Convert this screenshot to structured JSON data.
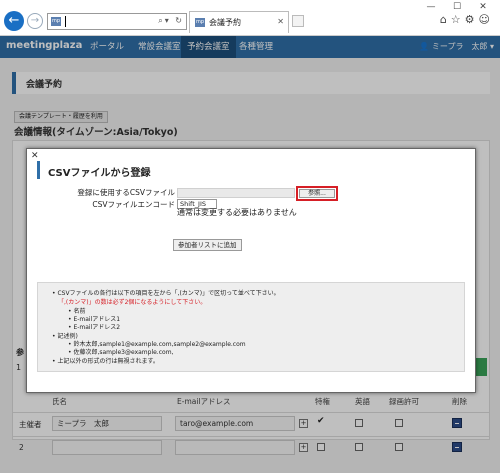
{
  "browser": {
    "tab_title": "会議予約",
    "favicon_text": "mp",
    "window_controls": [
      "—",
      "☐",
      "✕"
    ],
    "address_icons": "⌕▾ ↻",
    "browser_icons": "⌂☆⚙☺"
  },
  "nav": {
    "logo": "meetingplaza",
    "items": [
      "ポータル",
      "常設会議室",
      "予約会議室",
      "各種管理"
    ],
    "active_index": 2,
    "user": "ミープラ　太郎 ▾"
  },
  "page": {
    "section_title": "会議予約",
    "template_button": "会議テンプレート・履歴を利用",
    "conference_info": "会議情報(タイムゾーン:Asia/Tokyo)",
    "side_label_1": "参",
    "side_label_2": "1"
  },
  "participants": {
    "headers": [
      "氏名",
      "E-mailアドレス",
      "特権",
      "英語",
      "録画許可",
      "削除"
    ],
    "rows": [
      {
        "role": "主催者",
        "name": "ミープラ　太郎",
        "email": "taro@example.com",
        "privilege": "✔"
      },
      {
        "role": "2",
        "name": "",
        "email": "",
        "privilege": ""
      }
    ]
  },
  "modal": {
    "close_label": "✕",
    "title": "CSVファイルから登録",
    "label_csv": "登録に使用するCSVファイル",
    "label_encoding": "CSVファイルエンコード",
    "browse_button": "参照...",
    "encoding_value": "Shift_JIS",
    "encoding_note": "通常は変更する必要はありません",
    "add_button": "参加者リストに追加",
    "notes": [
      "• CSVファイルの各行は以下の項目を左から「,(カンマ)」で区切って並べて下さい。",
      "「,(カンマ)」の数は必ず2個になるようにして下さい。",
      "• 名前",
      "• E-mailアドレス1",
      "• E-mailアドレス2",
      "• 記述例)",
      "• 鈴木太郎,sample1@example.com,sample2@example.com",
      "• 佐藤次郎,sample3@example.com,",
      "• 上記以外の形式の行は無視されます。"
    ]
  },
  "colors": {
    "brand": "#2f6fa8",
    "highlight_red": "#d61f26",
    "add_green": "#3aa35a"
  }
}
